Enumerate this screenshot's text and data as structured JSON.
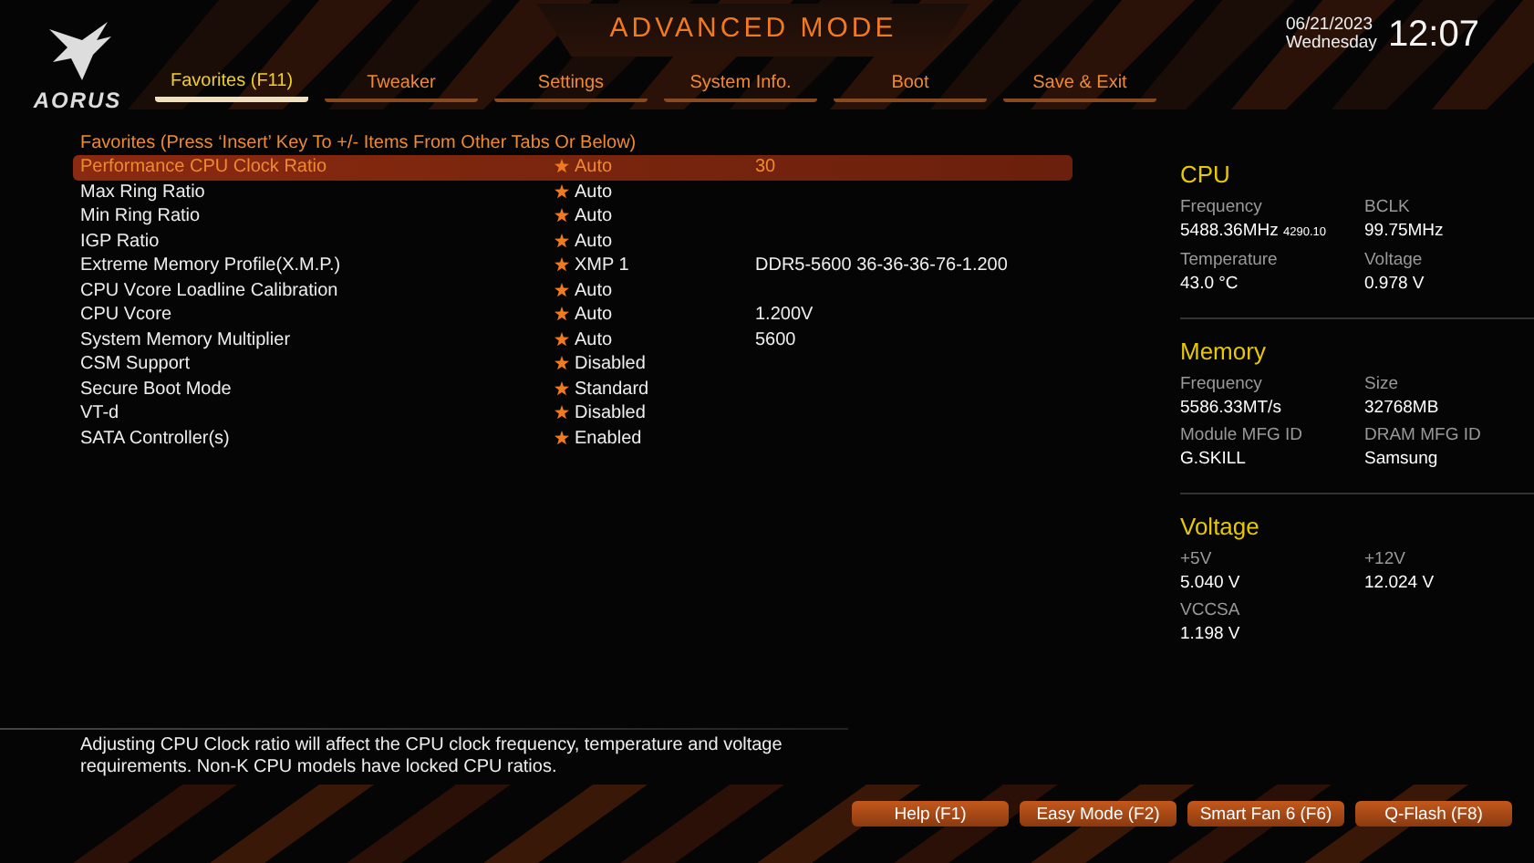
{
  "header": {
    "logo_text": "AORUS",
    "title": "ADVANCED MODE",
    "date": "06/21/2023",
    "weekday": "Wednesday",
    "time": "12:07"
  },
  "tabs": [
    {
      "label": "Favorites (F11)",
      "selected": true
    },
    {
      "label": "Tweaker",
      "selected": false
    },
    {
      "label": "Settings",
      "selected": false
    },
    {
      "label": "System Info.",
      "selected": false
    },
    {
      "label": "Boot",
      "selected": false
    },
    {
      "label": "Save & Exit",
      "selected": false
    }
  ],
  "favorites": {
    "heading": "Favorites (Press ‘Insert’ Key To +/- Items From Other Tabs Or Below)",
    "rows": [
      {
        "name": "Performance CPU Clock Ratio",
        "value": "Auto",
        "detail": "30",
        "selected": true
      },
      {
        "name": "Max Ring Ratio",
        "value": "Auto",
        "selected": false
      },
      {
        "name": "Min Ring Ratio",
        "value": "Auto",
        "selected": false
      },
      {
        "name": "IGP Ratio",
        "value": "Auto",
        "selected": false
      },
      {
        "name": "Extreme Memory Profile(X.M.P.)",
        "value": "XMP 1",
        "detail": "DDR5-5600 36-36-36-76-1.200",
        "selected": false
      },
      {
        "name": "CPU Vcore Loadline Calibration",
        "value": "Auto",
        "selected": false
      },
      {
        "name": "CPU Vcore",
        "value": "Auto",
        "detail": "1.200V",
        "selected": false
      },
      {
        "name": "System Memory Multiplier",
        "value": "Auto",
        "detail": "5600",
        "selected": false
      },
      {
        "name": "CSM Support",
        "value": "Disabled",
        "selected": false
      },
      {
        "name": "Secure Boot Mode",
        "value": "Standard",
        "selected": false
      },
      {
        "name": "VT-d",
        "value": "Disabled",
        "selected": false
      },
      {
        "name": "SATA Controller(s)",
        "value": "Enabled",
        "selected": false
      }
    ]
  },
  "system_panel": [
    {
      "title": "CPU",
      "fields": [
        {
          "label": "Frequency",
          "value": "5488.36MHz",
          "sub": "4290.10"
        },
        {
          "label": "BCLK",
          "value": "99.75MHz"
        },
        {
          "label": "Temperature",
          "value": "43.0 °C"
        },
        {
          "label": "Voltage",
          "value": "0.978 V"
        }
      ]
    },
    {
      "title": "Memory",
      "fields": [
        {
          "label": "Frequency",
          "value": "5586.33MT/s"
        },
        {
          "label": "Size",
          "value": "32768MB"
        },
        {
          "label": "Module MFG ID",
          "value": "G.SKILL"
        },
        {
          "label": "DRAM MFG ID",
          "value": "Samsung"
        }
      ]
    },
    {
      "title": "Voltage",
      "fields": [
        {
          "label": "+5V",
          "value": "5.040 V"
        },
        {
          "label": "+12V",
          "value": "12.024 V"
        },
        {
          "label": "VCCSA",
          "value": "1.198 V"
        }
      ]
    }
  ],
  "description": "Adjusting CPU Clock ratio will affect the CPU clock frequency, temperature and voltage requirements. Non-K CPU models have locked CPU ratios.",
  "buttons": [
    "Help (F1)",
    "Easy Mode (F2)",
    "Smart Fan 6 (F6)",
    "Q-Flash (F8)"
  ]
}
